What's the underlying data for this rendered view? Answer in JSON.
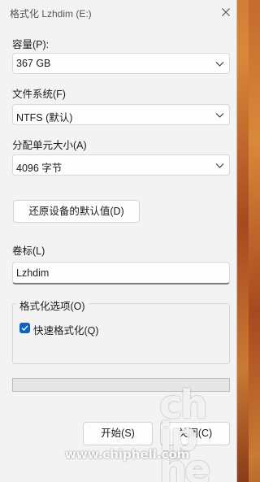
{
  "window": {
    "title": "格式化 Lzhdim (E:)"
  },
  "capacity": {
    "label": "容量(P):",
    "value": "367 GB"
  },
  "filesystem": {
    "label": "文件系统(F)",
    "value": "NTFS (默认)"
  },
  "allocation": {
    "label": "分配单元大小(A)",
    "value": "4096 字节"
  },
  "restore_defaults_label": "还原设备的默认值(D)",
  "volume": {
    "label": "卷标(L)",
    "value": "Lzhdim"
  },
  "format_options": {
    "label": "格式化选项(O)",
    "quick_format": {
      "label": "快速格式化(Q)",
      "checked": true
    }
  },
  "progress": {
    "value": 0
  },
  "buttons": {
    "start": "开始(S)",
    "close": "关闭(C)"
  },
  "watermark": {
    "side_text": "chip\nhell",
    "url": "www.chiphell.com"
  },
  "colors": {
    "accent": "#0a63c7",
    "window_bg": "#f3f3f3"
  },
  "icons": {
    "close": "close-icon",
    "dropdown": "chevron-down-icon",
    "check": "checkmark-icon"
  }
}
